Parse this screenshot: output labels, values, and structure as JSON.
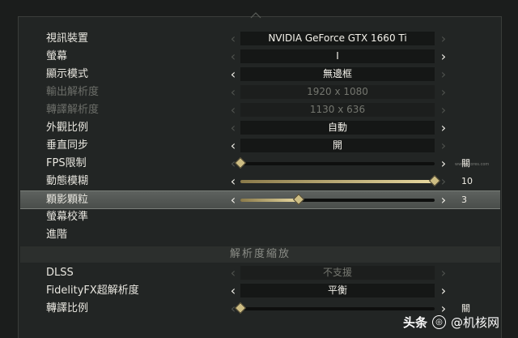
{
  "rows": [
    {
      "label": "視訊裝置",
      "type": "select",
      "value": "NVIDIA GeForce GTX 1660 Ti",
      "left_enabled": false,
      "right_enabled": false,
      "disabled": false
    },
    {
      "label": "螢幕",
      "type": "select",
      "value": "I",
      "left_enabled": false,
      "right_enabled": true,
      "disabled": false
    },
    {
      "label": "顯示模式",
      "type": "select",
      "value": "無邊框",
      "left_enabled": true,
      "right_enabled": false,
      "disabled": false
    },
    {
      "label": "輸出解析度",
      "type": "select",
      "value": "1920 x 1080",
      "left_enabled": false,
      "right_enabled": false,
      "disabled": true
    },
    {
      "label": "轉譯解析度",
      "type": "select",
      "value": "1130 x 636",
      "left_enabled": false,
      "right_enabled": false,
      "disabled": true
    },
    {
      "label": "外觀比例",
      "type": "select",
      "value": "自動",
      "left_enabled": false,
      "right_enabled": true,
      "disabled": false
    },
    {
      "label": "垂直同步",
      "type": "select",
      "value": "開",
      "left_enabled": true,
      "right_enabled": false,
      "disabled": false
    },
    {
      "label": "FPS限制",
      "type": "slider",
      "value": "關",
      "level": 0.0,
      "left_enabled": false,
      "right_enabled": true,
      "disabled": false
    },
    {
      "label": "動態模糊",
      "type": "slider",
      "value": "10",
      "level": 1.0,
      "left_enabled": true,
      "right_enabled": false,
      "disabled": false
    },
    {
      "label": "顆影顆粒",
      "type": "slider",
      "value": "3",
      "level": 0.3,
      "left_enabled": true,
      "right_enabled": true,
      "disabled": false,
      "highlight": true
    },
    {
      "label": "螢幕校準",
      "type": "link",
      "disabled": false
    },
    {
      "label": "進階",
      "type": "link",
      "disabled": false
    }
  ],
  "section_header": "解析度縮放",
  "rows2": [
    {
      "label": "DLSS",
      "type": "select",
      "value": "不支援",
      "left_enabled": false,
      "right_enabled": false,
      "disabled": false,
      "value_disabled": true
    },
    {
      "label": "FidelityFX超解析度",
      "type": "select",
      "value": "平衡",
      "left_enabled": true,
      "right_enabled": true,
      "disabled": false
    },
    {
      "label": "轉譯比例",
      "type": "slider",
      "value": "關",
      "level": 0.0,
      "left_enabled": false,
      "right_enabled": true,
      "disabled": false
    }
  ],
  "watermark": {
    "brand": "头条",
    "handle": "@机核网",
    "small": "www.gcores.com"
  },
  "icons": {
    "left": "chevron-left-icon",
    "right": "chevron-right-icon",
    "knob": "diamond-knob-icon"
  }
}
